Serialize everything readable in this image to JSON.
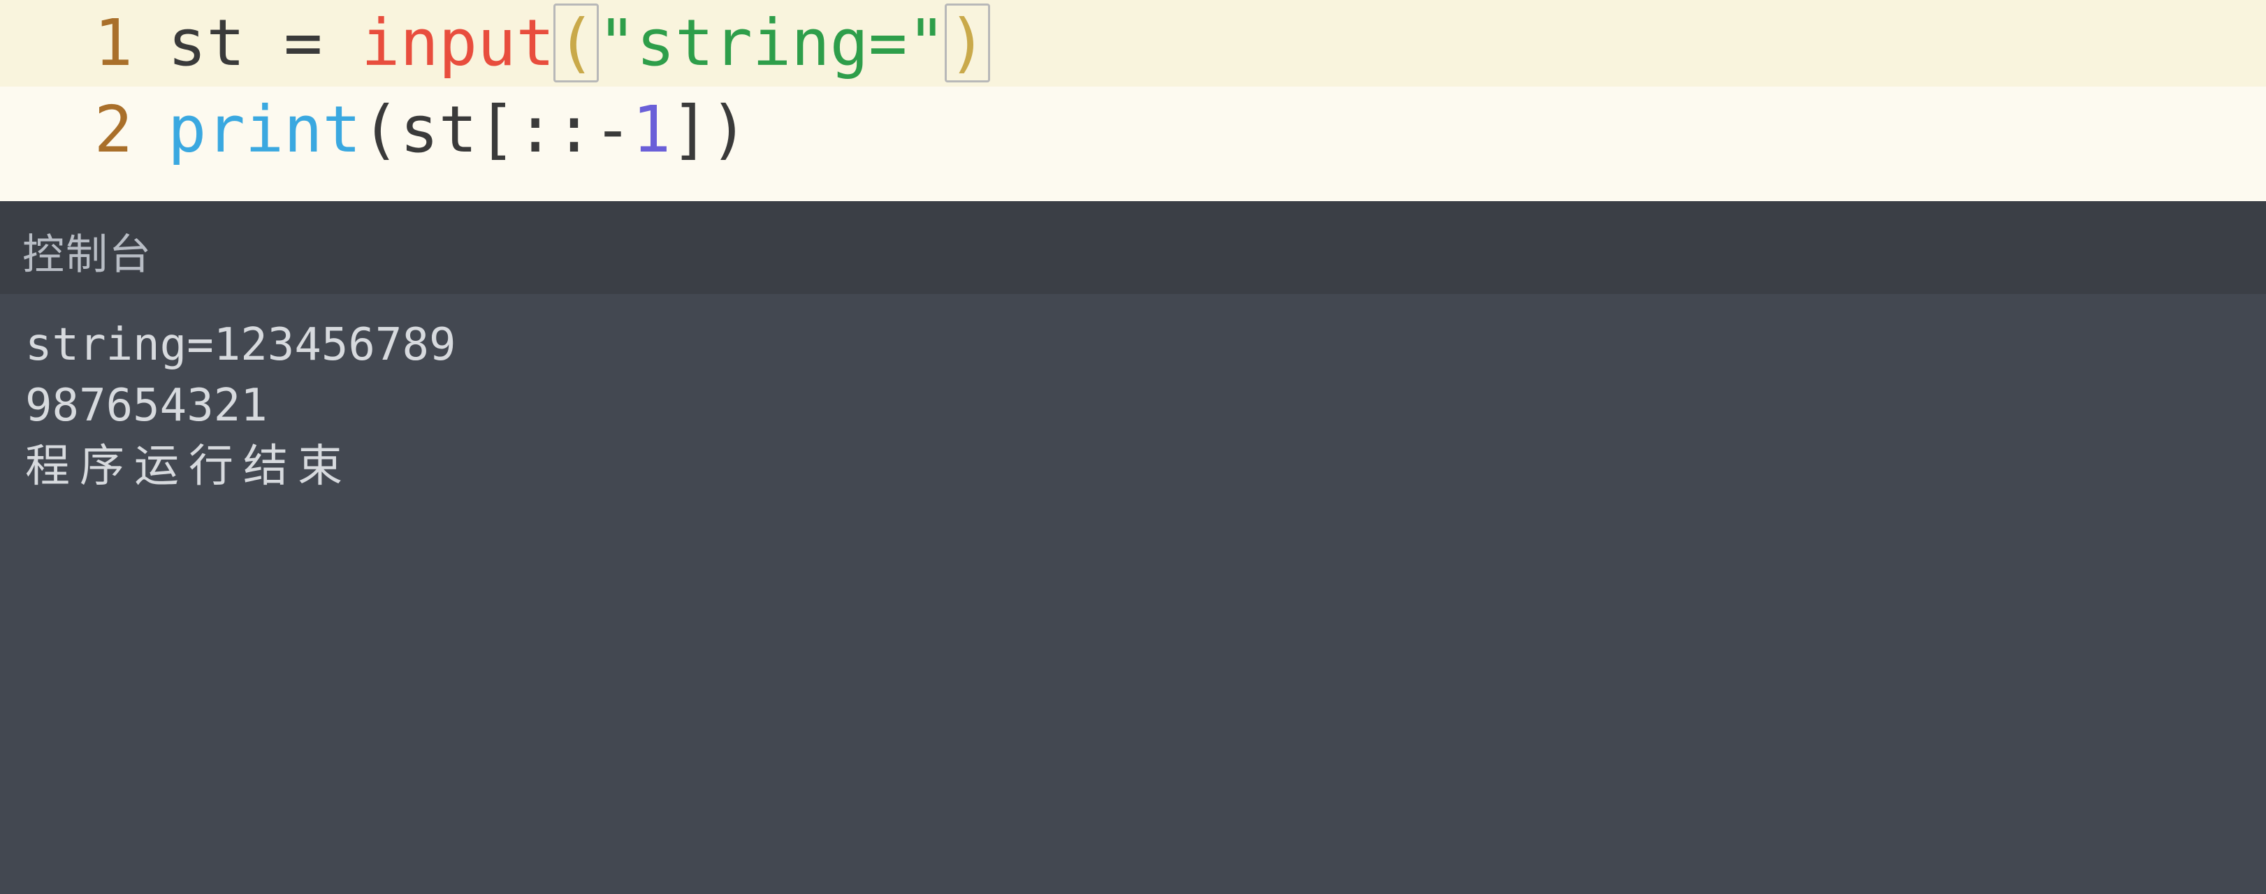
{
  "editor": {
    "lines": [
      {
        "num": "1",
        "current": true,
        "tokens": [
          {
            "cls": "tok-default",
            "text": "st "
          },
          {
            "cls": "tok-operator",
            "text": "="
          },
          {
            "cls": "tok-default",
            "text": " "
          },
          {
            "cls": "tok-builtin",
            "text": "input"
          },
          {
            "cls": "tok-paren paren-hl",
            "text": "("
          },
          {
            "cls": "tok-string",
            "text": "\"string=\""
          },
          {
            "cls": "tok-paren paren-hl",
            "text": ")"
          }
        ]
      },
      {
        "num": "2",
        "current": false,
        "tokens": [
          {
            "cls": "tok-builtin2",
            "text": "print"
          },
          {
            "cls": "tok-default",
            "text": "(st[::"
          },
          {
            "cls": "tok-operator",
            "text": "-"
          },
          {
            "cls": "tok-number",
            "text": "1"
          },
          {
            "cls": "tok-default",
            "text": "])"
          }
        ]
      }
    ]
  },
  "console": {
    "title": "控制台",
    "output": [
      {
        "text": "string=123456789",
        "cjk": false
      },
      {
        "text": "987654321",
        "cjk": false
      },
      {
        "text": "程序运行结束",
        "cjk": true
      }
    ]
  }
}
